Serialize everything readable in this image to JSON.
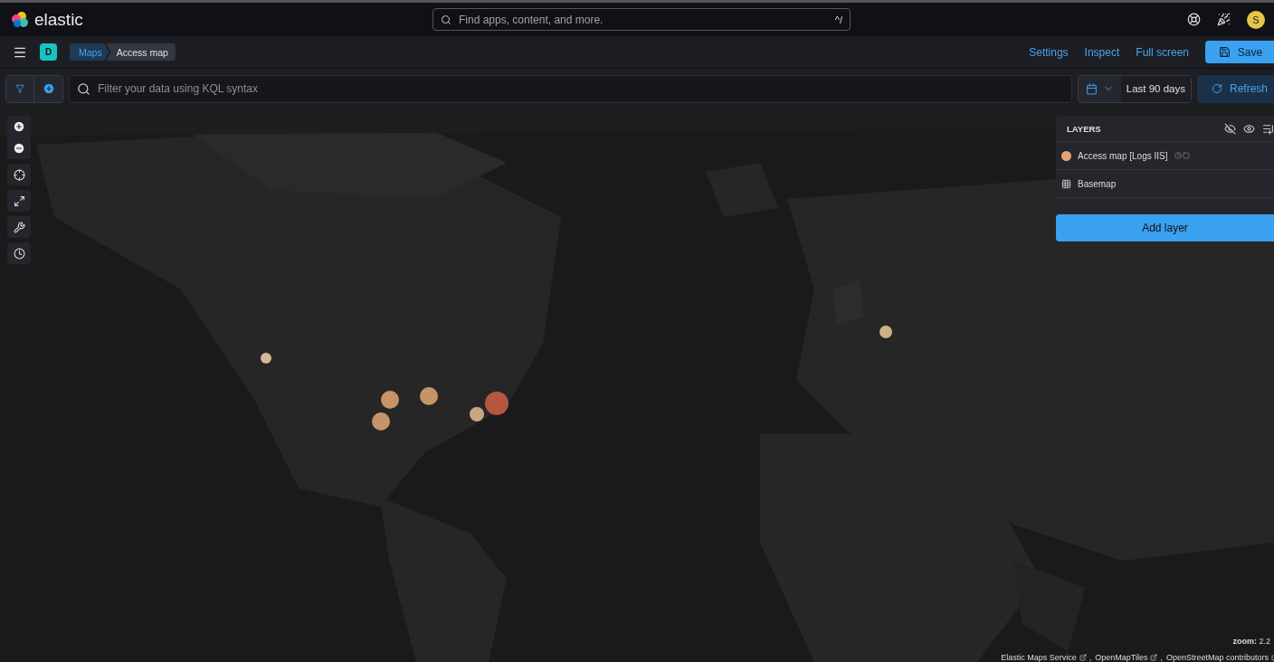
{
  "header": {
    "logo": "elastic",
    "search": {
      "placeholder": "Find apps, content, and more.",
      "shortcut": "^/"
    },
    "avatar": "S"
  },
  "nav": {
    "space": "D",
    "breadcrumbs": [
      {
        "label": "Maps",
        "selected": false
      },
      {
        "label": "Access map",
        "selected": true
      }
    ],
    "links": [
      "Settings",
      "Inspect",
      "Full screen"
    ],
    "save": "Save"
  },
  "query": {
    "placeholder": "Filter your data using KQL syntax",
    "date": "Last 90 days",
    "refresh": "Refresh"
  },
  "map": {
    "kind": "picture",
    "zoom": "**zoom:** 2.2",
    "separator": ",",
    "attributions": [
      "Elastic Maps Service",
      "OpenMapTiles",
      "OpenStreetMap contributors"
    ]
  },
  "layers": {
    "title": "LAYERS",
    "items": [
      {
        "kind": "points",
        "name": "Access map [Logs IIS]",
        "color": "#e7a473"
      },
      {
        "kind": "tiles",
        "name": "Basemap"
      }
    ],
    "add": "Add layer"
  }
}
